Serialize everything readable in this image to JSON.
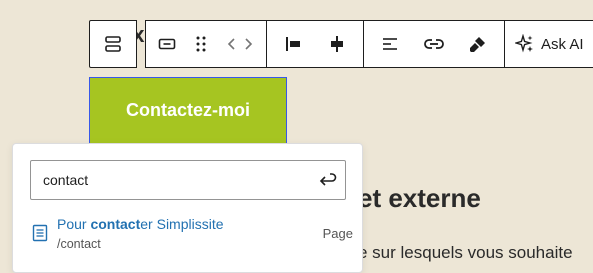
{
  "background_text": {
    "peek_title": "ex",
    "heading": "et externe",
    "paragraph": "e sur lesquels vous souhaite"
  },
  "toolbar": {
    "parent_icon": "block-group-icon",
    "ask_ai_label": "Ask AI"
  },
  "cta": {
    "label": "Contactez-moi"
  },
  "link_popover": {
    "search_value": "contact",
    "suggestion": {
      "title_match": "contact",
      "title_prefix": "Pour ",
      "title_suffix": "er Simplissite",
      "url": "/contact",
      "type": "Page"
    }
  },
  "colors": {
    "page_bg": "#ede6d6",
    "button_bg": "#a6c521",
    "link": "#2271b1",
    "focus": "#3858e9"
  }
}
